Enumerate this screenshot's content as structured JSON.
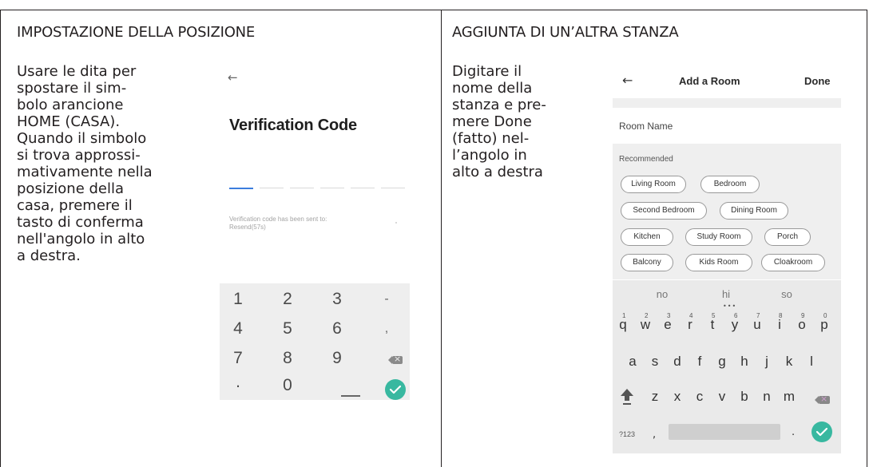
{
  "left_panel": {
    "heading": "IMPOSTAZIONE DELLA POSIZIONE",
    "instruction_lines": [
      "Usare le dita per",
      "spostare il sim-",
      "bolo arancione",
      "HOME (CASA).",
      "Quando il simbolo",
      "si trova approssi-",
      "mativamente nella",
      "posizione della",
      "casa, premere il",
      "tasto di conferma",
      "nell'angolo in alto",
      "a destra."
    ]
  },
  "right_panel": {
    "heading": "AGGIUNTA DI UN’ALTRA STANZA",
    "instruction_lines": [
      "Digitare il",
      "nome della",
      "stanza e pre-",
      "mere Done",
      "(fatto) nel-",
      "l’angolo in",
      "alto a destra"
    ]
  },
  "verification_screen": {
    "back_icon": "arrow-left-icon",
    "title": "Verification Code",
    "code_slot_count_shown": 6,
    "info_line1": "Verification code has been sent to:",
    "info_line2": "Resend(57s)",
    "keypad": {
      "rows": [
        [
          "1",
          "2",
          "3",
          "-"
        ],
        [
          "4",
          "5",
          "6",
          ","
        ],
        [
          "7",
          "8",
          "9",
          ""
        ],
        [
          ".",
          "0",
          "",
          ""
        ]
      ],
      "delete_icon": "backspace-icon",
      "confirm_icon": "check-icon",
      "confirm_color": "#38b8a0"
    }
  },
  "add_room_screen": {
    "back_icon": "arrow-left-icon",
    "title": "Add a Room",
    "done_label": "Done",
    "room_name_label": "Room Name",
    "recommended_label": "Recommended",
    "chips": [
      "Living Room",
      "Bedroom",
      "Second Bedroom",
      "Dining Room",
      "Kitchen",
      "Study Room",
      "Porch",
      "Balcony",
      "Kids Room",
      "Cloakroom"
    ],
    "keyboard": {
      "suggestions": [
        "no",
        "hi",
        "so"
      ],
      "row1": [
        "q",
        "w",
        "e",
        "r",
        "t",
        "y",
        "u",
        "i",
        "o",
        "p"
      ],
      "row1_numbers": [
        "1",
        "2",
        "3",
        "4",
        "5",
        "6",
        "7",
        "8",
        "9",
        "0"
      ],
      "row2": [
        "a",
        "s",
        "d",
        "f",
        "g",
        "h",
        "j",
        "k",
        "l"
      ],
      "row3": [
        "z",
        "x",
        "c",
        "v",
        "b",
        "n",
        "m"
      ],
      "symbols_label": "?123",
      "comma": ",",
      "period": ".",
      "shift_icon": "shift-icon",
      "delete_icon": "backspace-icon",
      "confirm_icon": "check-icon",
      "confirm_color": "#38b8a0"
    }
  }
}
